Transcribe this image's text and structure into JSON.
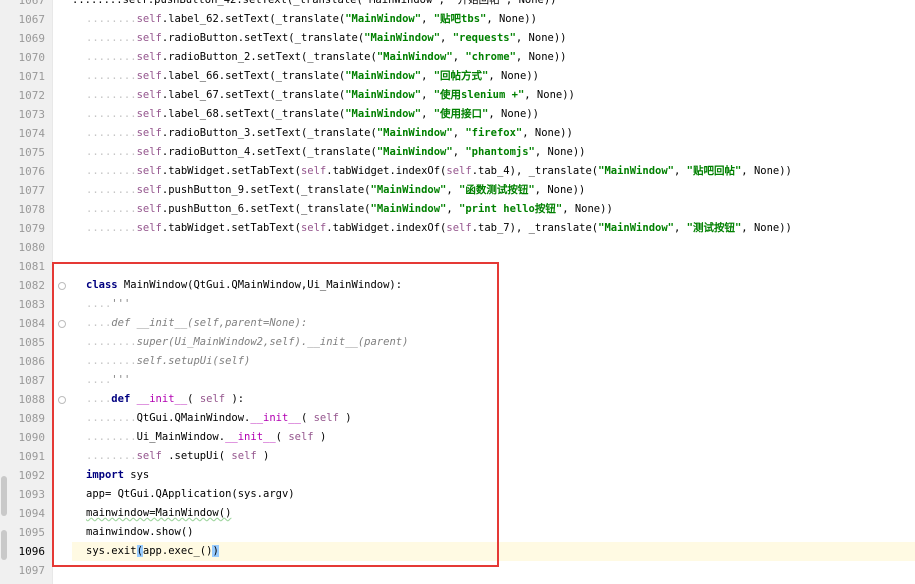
{
  "editor": {
    "lines": [
      {
        "num": "1067",
        "parts": [
          [
            "ind",
            "........"
          ],
          [
            "self",
            "self"
          ],
          [
            "",
            "."
          ],
          [
            "",
            "label_62.setText(_translate("
          ],
          [
            "str",
            "\"MainWindow\""
          ],
          [
            "",
            ", "
          ],
          [
            "str",
            "\"贴吧tbs\""
          ],
          [
            "",
            ", None))"
          ]
        ]
      },
      {
        "num": "1069",
        "parts": [
          [
            "ind",
            "........"
          ],
          [
            "self",
            "self"
          ],
          [
            "",
            "."
          ],
          [
            "",
            "radioButton.setText(_translate("
          ],
          [
            "str",
            "\"MainWindow\""
          ],
          [
            "",
            ", "
          ],
          [
            "str",
            "\"requests\""
          ],
          [
            "",
            ", None))"
          ]
        ]
      },
      {
        "num": "1070",
        "parts": [
          [
            "ind",
            "........"
          ],
          [
            "self",
            "self"
          ],
          [
            "",
            "."
          ],
          [
            "",
            "radioButton_2.setText(_translate("
          ],
          [
            "str",
            "\"MainWindow\""
          ],
          [
            "",
            ", "
          ],
          [
            "str",
            "\"chrome\""
          ],
          [
            "",
            ", None))"
          ]
        ]
      },
      {
        "num": "1071",
        "parts": [
          [
            "ind",
            "........"
          ],
          [
            "self",
            "self"
          ],
          [
            "",
            "."
          ],
          [
            "",
            "label_66.setText(_translate("
          ],
          [
            "str",
            "\"MainWindow\""
          ],
          [
            "",
            ", "
          ],
          [
            "str",
            "\"回帖方式\""
          ],
          [
            "",
            ", None))"
          ]
        ]
      },
      {
        "num": "1072",
        "parts": [
          [
            "ind",
            "........"
          ],
          [
            "self",
            "self"
          ],
          [
            "",
            "."
          ],
          [
            "",
            "label_67.setText(_translate("
          ],
          [
            "str",
            "\"MainWindow\""
          ],
          [
            "",
            ", "
          ],
          [
            "str",
            "\"使用slenium +\""
          ],
          [
            "",
            ", None))"
          ]
        ]
      },
      {
        "num": "1073",
        "parts": [
          [
            "ind",
            "........"
          ],
          [
            "self",
            "self"
          ],
          [
            "",
            "."
          ],
          [
            "",
            "label_68.setText(_translate("
          ],
          [
            "str",
            "\"MainWindow\""
          ],
          [
            "",
            ", "
          ],
          [
            "str",
            "\"使用接口\""
          ],
          [
            "",
            ", None))"
          ]
        ]
      },
      {
        "num": "1074",
        "parts": [
          [
            "ind",
            "........"
          ],
          [
            "self",
            "self"
          ],
          [
            "",
            "."
          ],
          [
            "",
            "radioButton_3.setText(_translate("
          ],
          [
            "str",
            "\"MainWindow\""
          ],
          [
            "",
            ", "
          ],
          [
            "str",
            "\"firefox\""
          ],
          [
            "",
            ", None))"
          ]
        ]
      },
      {
        "num": "1075",
        "parts": [
          [
            "ind",
            "........"
          ],
          [
            "self",
            "self"
          ],
          [
            "",
            "."
          ],
          [
            "",
            "radioButton_4.setText(_translate("
          ],
          [
            "str",
            "\"MainWindow\""
          ],
          [
            "",
            ", "
          ],
          [
            "str",
            "\"phantomjs\""
          ],
          [
            "",
            ", None))"
          ]
        ]
      },
      {
        "num": "1076",
        "parts": [
          [
            "ind",
            "........"
          ],
          [
            "self",
            "self"
          ],
          [
            "",
            "."
          ],
          [
            "",
            "tabWidget.setTabText("
          ],
          [
            "self",
            "self"
          ],
          [
            "",
            "."
          ],
          [
            "",
            "tabWidget.indexOf("
          ],
          [
            "self",
            "self"
          ],
          [
            "",
            ".tab_4), _translate("
          ],
          [
            "str",
            "\"MainWindow\""
          ],
          [
            "",
            ", "
          ],
          [
            "str",
            "\"贴吧回帖\""
          ],
          [
            "",
            ", None))"
          ]
        ]
      },
      {
        "num": "1077",
        "parts": [
          [
            "ind",
            "........"
          ],
          [
            "self",
            "self"
          ],
          [
            "",
            "."
          ],
          [
            "",
            "pushButton_9.setText(_translate("
          ],
          [
            "str",
            "\"MainWindow\""
          ],
          [
            "",
            ", "
          ],
          [
            "str",
            "\"函数测试按钮\""
          ],
          [
            "",
            ", None))"
          ]
        ]
      },
      {
        "num": "1078",
        "parts": [
          [
            "ind",
            "........"
          ],
          [
            "self",
            "self"
          ],
          [
            "",
            "."
          ],
          [
            "",
            "pushButton_6.setText(_translate("
          ],
          [
            "str",
            "\"MainWindow\""
          ],
          [
            "",
            ", "
          ],
          [
            "str",
            "\"print hello按钮\""
          ],
          [
            "",
            ", None))"
          ]
        ]
      },
      {
        "num": "1079",
        "parts": [
          [
            "ind",
            "........"
          ],
          [
            "self",
            "self"
          ],
          [
            "",
            "."
          ],
          [
            "",
            "tabWidget.setTabText("
          ],
          [
            "self",
            "self"
          ],
          [
            "",
            "."
          ],
          [
            "",
            "tabWidget.indexOf("
          ],
          [
            "self",
            "self"
          ],
          [
            "",
            ".tab_7), _translate("
          ],
          [
            "str",
            "\"MainWindow\""
          ],
          [
            "",
            ", "
          ],
          [
            "str",
            "\"测试按钮\""
          ],
          [
            "",
            ", None))"
          ]
        ]
      },
      {
        "num": "1080",
        "parts": []
      },
      {
        "num": "1081",
        "parts": []
      },
      {
        "num": "1082",
        "parts": [
          [
            "kw",
            "class"
          ],
          [
            "",
            " MainWindow(QtGui.QMainWindow,Ui_MainWindow):"
          ]
        ]
      },
      {
        "num": "1083",
        "parts": [
          [
            "ind",
            "...."
          ],
          [
            "cmt",
            "'''"
          ]
        ]
      },
      {
        "num": "1084",
        "parts": [
          [
            "ind",
            "...."
          ],
          [
            "cmt",
            "def __init__(self,parent=None):"
          ]
        ]
      },
      {
        "num": "1085",
        "parts": [
          [
            "ind",
            "........"
          ],
          [
            "cmt",
            "super(Ui_MainWindow2,self).__init__(parent)"
          ]
        ]
      },
      {
        "num": "1086",
        "parts": [
          [
            "ind",
            "........"
          ],
          [
            "cmt",
            "self.setupUi(self)"
          ]
        ]
      },
      {
        "num": "1087",
        "parts": [
          [
            "ind",
            "...."
          ],
          [
            "cmt",
            "'''"
          ]
        ]
      },
      {
        "num": "1088",
        "parts": [
          [
            "ind",
            "...."
          ],
          [
            "kw",
            "def"
          ],
          [
            "",
            " "
          ],
          [
            "magic",
            "__init__"
          ],
          [
            "",
            "( "
          ],
          [
            "self",
            "self"
          ],
          [
            "",
            " ):"
          ]
        ]
      },
      {
        "num": "1089",
        "parts": [
          [
            "ind",
            "........"
          ],
          [
            "",
            "QtGui.QMainWindow."
          ],
          [
            "magic",
            "__init__"
          ],
          [
            "",
            "( "
          ],
          [
            "self",
            "self"
          ],
          [
            "",
            " )"
          ]
        ]
      },
      {
        "num": "1090",
        "parts": [
          [
            "ind",
            "........"
          ],
          [
            "",
            "Ui_MainWindow."
          ],
          [
            "magic",
            "__init__"
          ],
          [
            "",
            "( "
          ],
          [
            "self",
            "self"
          ],
          [
            "",
            " )"
          ]
        ]
      },
      {
        "num": "1091",
        "parts": [
          [
            "ind",
            "........"
          ],
          [
            "self",
            "self"
          ],
          [
            "",
            " .setupUi( "
          ],
          [
            "self",
            "self"
          ],
          [
            "",
            " )"
          ]
        ]
      },
      {
        "num": "1092",
        "parts": [
          [
            "kw",
            "import"
          ],
          [
            "",
            " sys"
          ]
        ]
      },
      {
        "num": "1093",
        "parts": [
          [
            "",
            "app= QtGui.QApplication(sys.argv)"
          ]
        ]
      },
      {
        "num": "1094",
        "parts": [
          [
            "",
            "mainwindow=MainWindow()"
          ]
        ]
      },
      {
        "num": "1095",
        "parts": [
          [
            "",
            "mainwindow.show()"
          ]
        ]
      },
      {
        "num": "1096",
        "parts": [
          [
            "",
            "sys.exit"
          ],
          [
            "paren",
            "("
          ],
          [
            "",
            "app.exec_()"
          ],
          [
            "paren",
            ")"
          ]
        ]
      },
      {
        "num": "1097",
        "parts": []
      }
    ],
    "partial_top_line": {
      "num": "1067",
      "text_prefix": "........self.pushButton_42.setText(_translate(\"MainWindow\", \"开始回帖\", None))"
    }
  }
}
